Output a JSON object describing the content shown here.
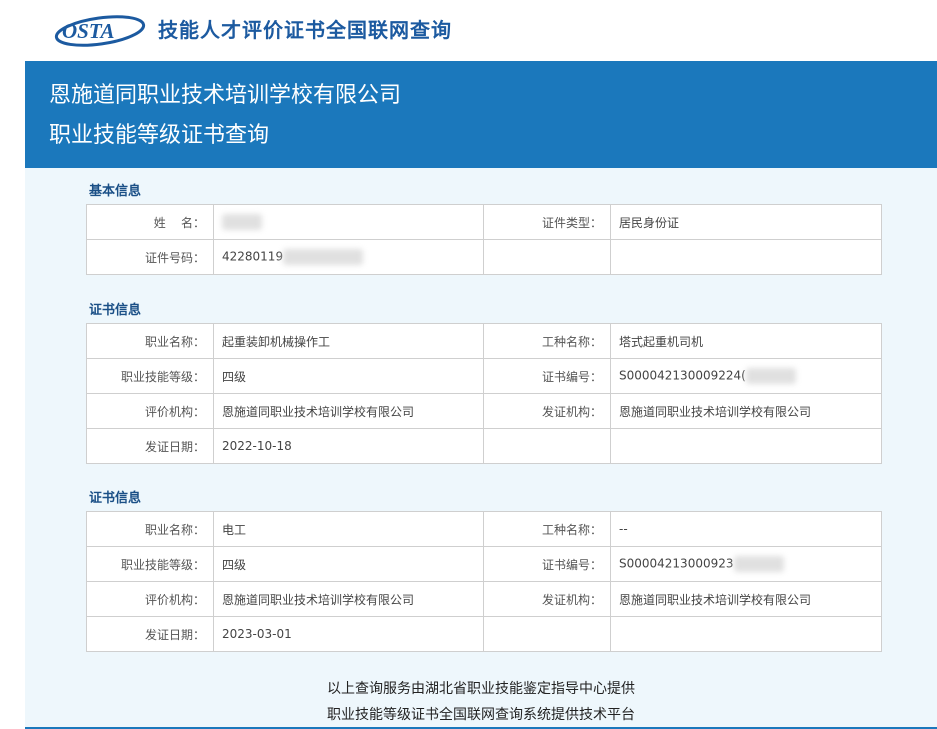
{
  "header": {
    "logo_text": "OSTA",
    "site_title": "技能人才评价证书全国联网查询"
  },
  "banner": {
    "company": "恩施道同职业技术培训学校有限公司",
    "subtitle": "职业技能等级证书查询"
  },
  "basic_info": {
    "title": "基本信息",
    "name_label": "姓    名：",
    "name_value": "",
    "id_type_label": "证件类型：",
    "id_type_value": "居民身份证",
    "id_number_label": "证件号码：",
    "id_number_value": "42280119"
  },
  "certificates": [
    {
      "title": "证书信息",
      "occupation_label": "职业名称：",
      "occupation_value": "起重装卸机械操作工",
      "trade_label": "工种名称：",
      "trade_value": "塔式起重机司机",
      "level_label": "职业技能等级：",
      "level_value": "四级",
      "cert_no_label": "证书编号：",
      "cert_no_value": "S000042130009224(",
      "evaluator_label": "评价机构：",
      "evaluator_value": "恩施道同职业技术培训学校有限公司",
      "issuer_label": "发证机构：",
      "issuer_value": "恩施道同职业技术培训学校有限公司",
      "date_label": "发证日期：",
      "date_value": "2022-10-18"
    },
    {
      "title": "证书信息",
      "occupation_label": "职业名称：",
      "occupation_value": "电工",
      "trade_label": "工种名称：",
      "trade_value": "--",
      "level_label": "职业技能等级：",
      "level_value": "四级",
      "cert_no_label": "证书编号：",
      "cert_no_value": "S00004213000923",
      "evaluator_label": "评价机构：",
      "evaluator_value": "恩施道同职业技术培训学校有限公司",
      "issuer_label": "发证机构：",
      "issuer_value": "恩施道同职业技术培训学校有限公司",
      "date_label": "发证日期：",
      "date_value": "2023-03-01"
    }
  ],
  "footer": {
    "line1": "以上查询服务由湖北省职业技能鉴定指导中心提供",
    "line2": "职业技能等级证书全国联网查询系统提供技术平台"
  },
  "colors": {
    "brand_blue": "#1b78bc",
    "title_blue": "#1c5aa0",
    "panel_bg": "#eef7fc"
  }
}
